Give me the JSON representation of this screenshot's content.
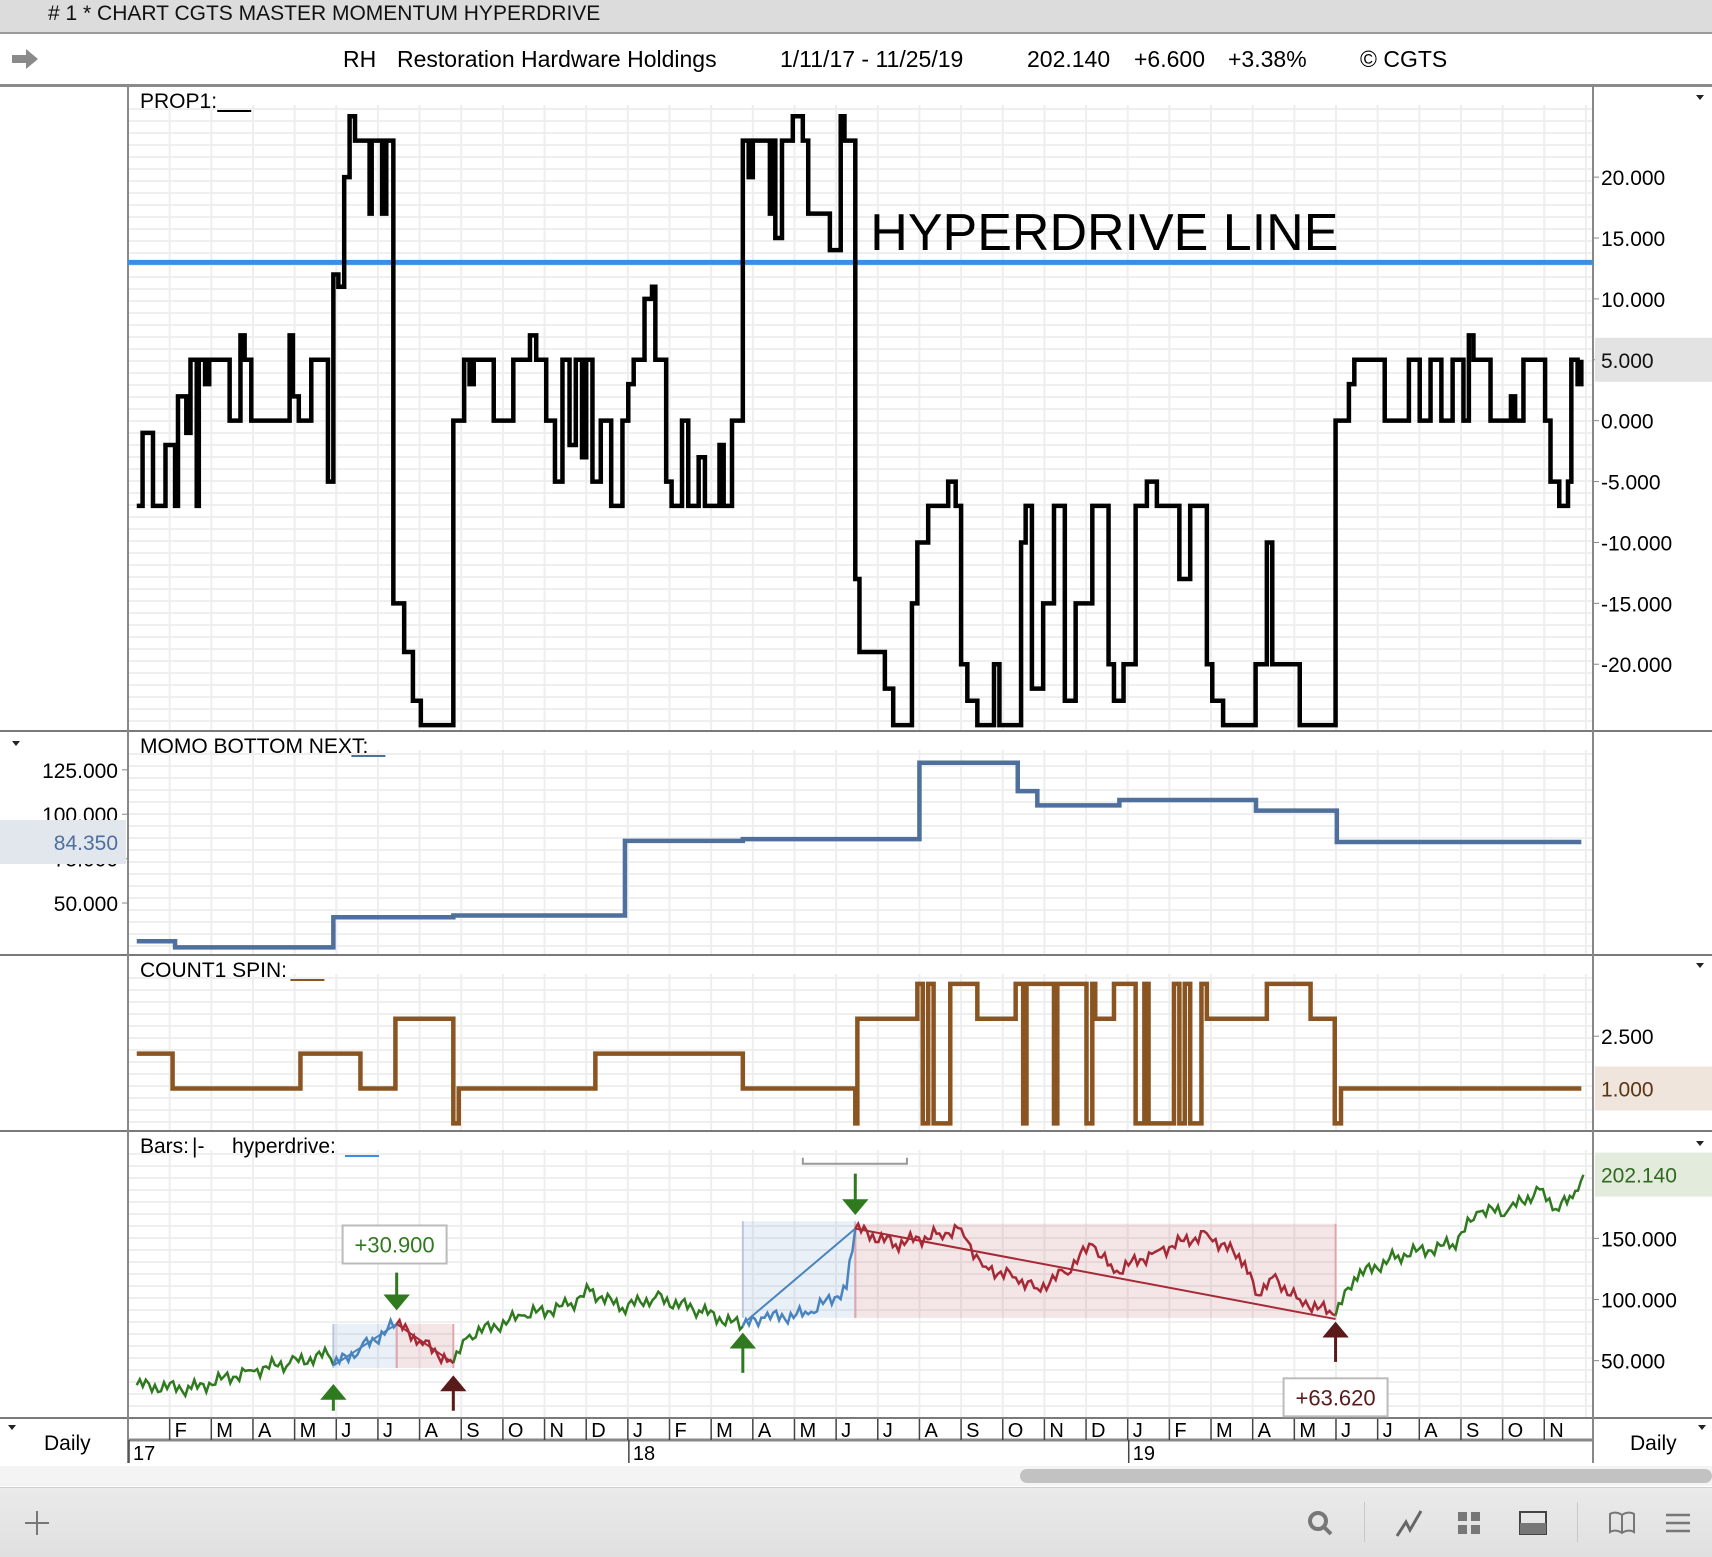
{
  "window": {
    "title": "# 1 * CHART CGTS MASTER MOMENTUM HYPERDRIVE"
  },
  "header": {
    "symbol": "RH",
    "company": "Restoration Hardware Holdings",
    "date_range": "1/11/17 - 11/25/19",
    "last": "202.140",
    "change": "+6.600",
    "change_pct": "+3.38%",
    "copyright": "© CGTS"
  },
  "footer": {
    "period_left": "Daily",
    "period_right": "Daily"
  },
  "toolbar": {
    "icons": [
      "plus-icon",
      "search-icon",
      "line-chart-icon",
      "grid-icon",
      "panel-layout-icon",
      "book-icon",
      "menu-icon"
    ]
  },
  "colors": {
    "prop": "#000000",
    "hyperdrive": "#3a8ee6",
    "momo": "#4f6f9c",
    "count": "#8a5520",
    "green": "#2f7a1f",
    "blue": "#4a84bf",
    "red": "#a62a36",
    "darkred": "#5a1a1a"
  },
  "chart_data": [
    {
      "type": "line",
      "title": "PROP1:",
      "step": true,
      "xlim": [
        0,
        35.17
      ],
      "ylim": [
        -25.4,
        27.4
      ],
      "yticks": [
        "20.000",
        "15.000",
        "10.000",
        "5.000",
        "0.000",
        "-5.000",
        "-10.000",
        "-15.000",
        "-20.000"
      ],
      "ytick_values": [
        20,
        15,
        10,
        5,
        0,
        -5,
        -10,
        -15,
        -20
      ],
      "current_value": "5.000",
      "hline": {
        "label": "HYPERDRIVE LINE",
        "value": 13,
        "label_x": 17.82,
        "label_y": 14.0
      },
      "points": [
        [
          0.21,
          -7
        ],
        [
          0.35,
          -1
        ],
        [
          0.6,
          -7
        ],
        [
          0.9,
          -2
        ],
        [
          1.13,
          -7
        ],
        [
          1.2,
          2
        ],
        [
          1.4,
          -1
        ],
        [
          1.5,
          5
        ],
        [
          1.65,
          -7
        ],
        [
          1.7,
          5
        ],
        [
          1.85,
          3
        ],
        [
          1.95,
          5
        ],
        [
          2.44,
          0
        ],
        [
          2.7,
          7
        ],
        [
          2.8,
          5
        ],
        [
          2.96,
          0
        ],
        [
          3.88,
          7
        ],
        [
          3.96,
          2
        ],
        [
          4.1,
          0
        ],
        [
          4.4,
          5
        ],
        [
          4.8,
          -5
        ],
        [
          4.93,
          12
        ],
        [
          5.05,
          11
        ],
        [
          5.19,
          20
        ],
        [
          5.32,
          25
        ],
        [
          5.45,
          23
        ],
        [
          5.8,
          17
        ],
        [
          5.85,
          23
        ],
        [
          6.1,
          17
        ],
        [
          6.2,
          23
        ],
        [
          6.37,
          -15
        ],
        [
          6.63,
          -19
        ],
        [
          6.84,
          -23
        ],
        [
          7.03,
          -25
        ],
        [
          7.81,
          0
        ],
        [
          8.07,
          5
        ],
        [
          8.2,
          3
        ],
        [
          8.3,
          5
        ],
        [
          8.78,
          0
        ],
        [
          9.25,
          5
        ],
        [
          9.65,
          7
        ],
        [
          9.8,
          5
        ],
        [
          10.04,
          0
        ],
        [
          10.25,
          -5
        ],
        [
          10.43,
          5
        ],
        [
          10.6,
          -2
        ],
        [
          10.75,
          5
        ],
        [
          10.9,
          -3
        ],
        [
          11.0,
          5
        ],
        [
          11.15,
          -5
        ],
        [
          11.35,
          0
        ],
        [
          11.6,
          -7
        ],
        [
          11.87,
          0
        ],
        [
          12.01,
          3
        ],
        [
          12.14,
          5
        ],
        [
          12.4,
          10
        ],
        [
          12.58,
          11
        ],
        [
          12.66,
          5
        ],
        [
          12.92,
          -5
        ],
        [
          13.05,
          -7
        ],
        [
          13.3,
          0
        ],
        [
          13.45,
          -7
        ],
        [
          13.7,
          -3
        ],
        [
          13.85,
          -7
        ],
        [
          14.2,
          -2
        ],
        [
          14.3,
          -7
        ],
        [
          14.5,
          0
        ],
        [
          14.76,
          23
        ],
        [
          14.9,
          20
        ],
        [
          15.0,
          23
        ],
        [
          15.41,
          17
        ],
        [
          15.5,
          23
        ],
        [
          15.54,
          15
        ],
        [
          15.7,
          23
        ],
        [
          15.96,
          25
        ],
        [
          16.2,
          23
        ],
        [
          16.33,
          17
        ],
        [
          16.85,
          14
        ],
        [
          17.11,
          25
        ],
        [
          17.2,
          23
        ],
        [
          17.46,
          -13
        ],
        [
          17.56,
          -19
        ],
        [
          18.17,
          -22
        ],
        [
          18.37,
          -25
        ],
        [
          18.82,
          -15
        ],
        [
          18.95,
          -10
        ],
        [
          19.21,
          -7
        ],
        [
          19.69,
          -5
        ],
        [
          19.87,
          -7
        ],
        [
          20.0,
          -20
        ],
        [
          20.15,
          -23
        ],
        [
          20.39,
          -25
        ],
        [
          20.79,
          -20
        ],
        [
          20.92,
          -25
        ],
        [
          21.31,
          -25
        ],
        [
          21.44,
          -10
        ],
        [
          21.55,
          -7
        ],
        [
          21.7,
          -22
        ],
        [
          21.97,
          -15
        ],
        [
          22.23,
          -7
        ],
        [
          22.49,
          -23
        ],
        [
          22.75,
          -15
        ],
        [
          23.15,
          -7
        ],
        [
          23.54,
          -20
        ],
        [
          23.67,
          -23
        ],
        [
          23.9,
          -20
        ],
        [
          24.19,
          -7
        ],
        [
          24.46,
          -5
        ],
        [
          24.7,
          -7
        ],
        [
          25.24,
          -13
        ],
        [
          25.5,
          -7
        ],
        [
          25.9,
          -20
        ],
        [
          26.03,
          -23
        ],
        [
          26.29,
          -25
        ],
        [
          26.81,
          -25
        ],
        [
          27.07,
          -20
        ],
        [
          27.34,
          -10
        ],
        [
          27.47,
          -20
        ],
        [
          28.13,
          -25
        ],
        [
          28.99,
          0
        ],
        [
          29.31,
          3
        ],
        [
          29.44,
          5
        ],
        [
          30.09,
          5
        ],
        [
          30.17,
          0
        ],
        [
          30.62,
          0
        ],
        [
          30.75,
          5
        ],
        [
          31.01,
          0
        ],
        [
          31.27,
          5
        ],
        [
          31.53,
          0
        ],
        [
          31.8,
          5
        ],
        [
          32.06,
          0
        ],
        [
          32.19,
          7
        ],
        [
          32.3,
          5
        ],
        [
          32.71,
          0
        ],
        [
          33.11,
          0
        ],
        [
          33.2,
          2
        ],
        [
          33.3,
          0
        ],
        [
          33.5,
          5
        ],
        [
          33.89,
          5
        ],
        [
          34.02,
          0
        ],
        [
          34.15,
          -5
        ],
        [
          34.36,
          -7
        ],
        [
          34.57,
          -5
        ],
        [
          34.65,
          5
        ],
        [
          34.8,
          3
        ],
        [
          34.89,
          5
        ]
      ]
    },
    {
      "type": "line",
      "title": "MOMO BOTTOM NEXT:",
      "step": true,
      "xlim": [
        0,
        35.17
      ],
      "ylim": [
        21.3,
        146.3
      ],
      "yticks": [
        "125.000",
        "100.000",
        "75.000",
        "50.000"
      ],
      "ytick_values": [
        125,
        100,
        75,
        50
      ],
      "current_value": "84.350",
      "points": [
        [
          0.21,
          28.5
        ],
        [
          1.13,
          25
        ],
        [
          4.93,
          42
        ],
        [
          7.81,
          43
        ],
        [
          11.93,
          85
        ],
        [
          14.76,
          86
        ],
        [
          19.0,
          129
        ],
        [
          21.36,
          113
        ],
        [
          21.83,
          105
        ],
        [
          23.8,
          108
        ],
        [
          27.08,
          102
        ],
        [
          29.02,
          84.35
        ],
        [
          34.89,
          84.35
        ]
      ]
    },
    {
      "type": "line",
      "title": "COUNT1 SPIN:",
      "step": true,
      "xlim": [
        0,
        35.17
      ],
      "ylim": [
        -0.19,
        4.8
      ],
      "yticks": [
        "2.500"
      ],
      "ytick_values": [
        2.5
      ],
      "current_value": "1.000",
      "points": [
        [
          0.21,
          2
        ],
        [
          1.07,
          1
        ],
        [
          4.14,
          2
        ],
        [
          5.58,
          1
        ],
        [
          6.42,
          3
        ],
        [
          7.81,
          0
        ],
        [
          7.94,
          1
        ],
        [
          11.22,
          2
        ],
        [
          14.76,
          1
        ],
        [
          17.46,
          0
        ],
        [
          17.51,
          3
        ],
        [
          18.95,
          4
        ],
        [
          19.08,
          0
        ],
        [
          19.21,
          4
        ],
        [
          19.34,
          0
        ],
        [
          19.74,
          4
        ],
        [
          19.95,
          4
        ],
        [
          20.39,
          3
        ],
        [
          21.31,
          4
        ],
        [
          21.49,
          0
        ],
        [
          21.57,
          4
        ],
        [
          22.23,
          0
        ],
        [
          22.31,
          4
        ],
        [
          23.01,
          0
        ],
        [
          23.15,
          4
        ],
        [
          23.22,
          3
        ],
        [
          23.67,
          4
        ],
        [
          24.19,
          0
        ],
        [
          24.4,
          4
        ],
        [
          24.5,
          0
        ],
        [
          25.11,
          4
        ],
        [
          25.24,
          0
        ],
        [
          25.37,
          4
        ],
        [
          25.5,
          0
        ],
        [
          25.77,
          4
        ],
        [
          25.9,
          3
        ],
        [
          27.34,
          4
        ],
        [
          28.39,
          3
        ],
        [
          28.97,
          0
        ],
        [
          29.12,
          1
        ],
        [
          34.89,
          1
        ]
      ]
    },
    {
      "type": "line",
      "title": "Bars:",
      "bars_style": "|-",
      "overlay_title": "hyperdrive:",
      "xlim": [
        0,
        35.17
      ],
      "ylim": [
        3.9,
        237
      ],
      "yticks": [
        "150.000",
        "100.000",
        "50.000"
      ],
      "ytick_values": [
        150,
        100,
        50
      ],
      "current_value": "202.140",
      "points": [
        [
          0.21,
          30
        ],
        [
          1.52,
          27
        ],
        [
          2.96,
          42
        ],
        [
          3.88,
          48
        ],
        [
          4.8,
          55
        ],
        [
          4.93,
          46
        ],
        [
          5.58,
          60
        ],
        [
          6.45,
          80
        ],
        [
          7.0,
          66
        ],
        [
          7.81,
          48
        ],
        [
          8.2,
          71
        ],
        [
          9.52,
          87
        ],
        [
          10.56,
          95
        ],
        [
          11.09,
          107
        ],
        [
          11.87,
          93
        ],
        [
          12.66,
          102
        ],
        [
          13.71,
          91
        ],
        [
          14.76,
          78
        ],
        [
          15.28,
          85
        ],
        [
          16.33,
          88
        ],
        [
          17.25,
          109
        ],
        [
          17.46,
          158
        ],
        [
          18.43,
          145
        ],
        [
          19.48,
          154
        ],
        [
          20.0,
          158
        ],
        [
          20.52,
          127
        ],
        [
          21.31,
          118
        ],
        [
          21.83,
          109
        ],
        [
          22.49,
          122
        ],
        [
          23.15,
          145
        ],
        [
          23.67,
          122
        ],
        [
          24.72,
          140
        ],
        [
          25.9,
          154
        ],
        [
          26.81,
          131
        ],
        [
          27.07,
          104
        ],
        [
          27.47,
          118
        ],
        [
          28.13,
          100
        ],
        [
          28.99,
          87
        ],
        [
          29.44,
          118
        ],
        [
          30.49,
          136
        ],
        [
          31.8,
          145
        ],
        [
          32.45,
          172
        ],
        [
          33.11,
          172
        ],
        [
          33.89,
          190
        ],
        [
          34.28,
          174
        ],
        [
          34.68,
          183
        ],
        [
          34.94,
          202
        ]
      ],
      "segments": [
        {
          "from": 0,
          "to": 4.93,
          "color": "green"
        },
        {
          "from": 4.93,
          "to": 6.45,
          "color": "blue"
        },
        {
          "from": 6.45,
          "to": 7.81,
          "color": "red"
        },
        {
          "from": 7.81,
          "to": 14.76,
          "color": "green"
        },
        {
          "from": 14.76,
          "to": 17.46,
          "color": "blue"
        },
        {
          "from": 17.46,
          "to": 28.99,
          "color": "red"
        },
        {
          "from": 28.99,
          "to": 35,
          "color": "green"
        }
      ],
      "zones": [
        {
          "from": 4.93,
          "to": 6.45,
          "low": 44,
          "high": 80,
          "color": "blue"
        },
        {
          "from": 6.45,
          "to": 7.81,
          "low": 44,
          "high": 80,
          "color": "red"
        },
        {
          "from": 14.76,
          "to": 17.46,
          "low": 85,
          "high": 164,
          "color": "blue"
        },
        {
          "from": 17.46,
          "to": 28.99,
          "low": 85,
          "high": 162,
          "color": "red"
        }
      ],
      "trend_lines": [
        {
          "from": [
            4.93,
            46
          ],
          "to": [
            6.45,
            80
          ],
          "color": "blue"
        },
        {
          "from": [
            6.45,
            80
          ],
          "to": [
            7.81,
            48
          ],
          "color": "red"
        },
        {
          "from": [
            14.76,
            80
          ],
          "to": [
            17.46,
            158
          ],
          "color": "blue"
        },
        {
          "from": [
            17.46,
            158
          ],
          "to": [
            28.99,
            84
          ],
          "color": "red"
        }
      ],
      "arrows": [
        {
          "t": 4.93,
          "tail": 9,
          "head": 29,
          "color": "green"
        },
        {
          "t": 6.45,
          "tail": 122,
          "head": 93,
          "color": "green"
        },
        {
          "t": 7.81,
          "tail": 9,
          "head": 36,
          "color": "darkred"
        },
        {
          "t": 14.76,
          "tail": 40,
          "head": 71,
          "color": "green"
        },
        {
          "t": 17.46,
          "tail": 203,
          "head": 171,
          "color": "green"
        },
        {
          "t": 28.99,
          "tail": 49,
          "head": 80,
          "color": "darkred"
        }
      ],
      "labels": [
        {
          "text": "+30.900",
          "t": 6.4,
          "v": 145,
          "color": "green"
        },
        {
          "text": "+63.620",
          "t": 28.99,
          "v": 20,
          "color": "darkred"
        }
      ],
      "bracket": {
        "from": 16.2,
        "to": 18.7,
        "v": 211
      }
    }
  ],
  "time_axis": {
    "months": [
      "F",
      "M",
      "A",
      "M",
      "J",
      "J",
      "A",
      "S",
      "O",
      "N",
      "D",
      "J",
      "F",
      "M",
      "A",
      "M",
      "J",
      "J",
      "A",
      "S",
      "O",
      "N",
      "D",
      "J",
      "F",
      "M",
      "A",
      "M",
      "J",
      "J",
      "A",
      "S",
      "O",
      "N"
    ],
    "years": [
      {
        "label": "17",
        "t": 0
      },
      {
        "label": "18",
        "t": 12
      },
      {
        "label": "19",
        "t": 24
      }
    ]
  }
}
